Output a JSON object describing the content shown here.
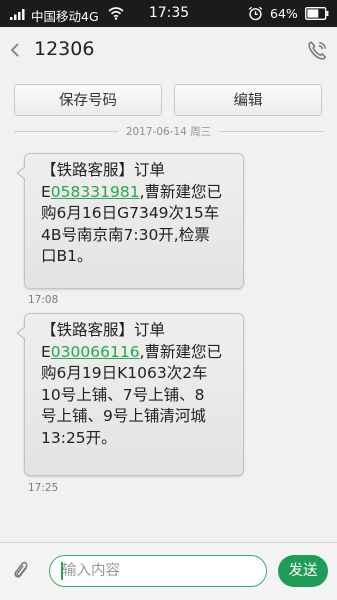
{
  "status_bar": {
    "carrier": "中国移动4G",
    "time": "17:35",
    "battery_percent": "64%",
    "icons": [
      "signal-icon",
      "wifi-icon",
      "alarm-icon",
      "battery-icon"
    ],
    "battery_level": 0.64
  },
  "header": {
    "back_icon": "chevron-left-icon",
    "contact": "12306",
    "call_icon": "phone-icon"
  },
  "actions": {
    "save_number": "保存号码",
    "edit": "编辑"
  },
  "date_divider": "2017-06-14 周三",
  "messages": [
    {
      "lines": [
        {
          "text": "【铁路客服】订单"
        },
        {
          "prefix": "E",
          "link": "058331981",
          "suffix": ",曹新建您已"
        },
        {
          "text": "购6月16日G7349次15车"
        },
        {
          "text": "4B号南京南7:30开,检票"
        },
        {
          "text": "口B1。"
        }
      ],
      "time": "17:08"
    },
    {
      "lines": [
        {
          "text": "【铁路客服】订单"
        },
        {
          "prefix": "E",
          "link": "030066116",
          "suffix": ",曹新建您已"
        },
        {
          "text": "购6月19日K1063次2车"
        },
        {
          "text": "10号上铺、7号上铺、8"
        },
        {
          "text": "号上铺、9号上铺清河城"
        },
        {
          "text": "13:25开。"
        }
      ],
      "time": "17:25"
    }
  ],
  "composer": {
    "attach_icon": "paperclip-icon",
    "placeholder": "输入内容",
    "send_label": "发送"
  },
  "colors": {
    "accent": "#1f9d58",
    "link": "#26a84c",
    "status_bar_bg": "#1b1b1b",
    "page_bg": "#f1f1f1"
  }
}
